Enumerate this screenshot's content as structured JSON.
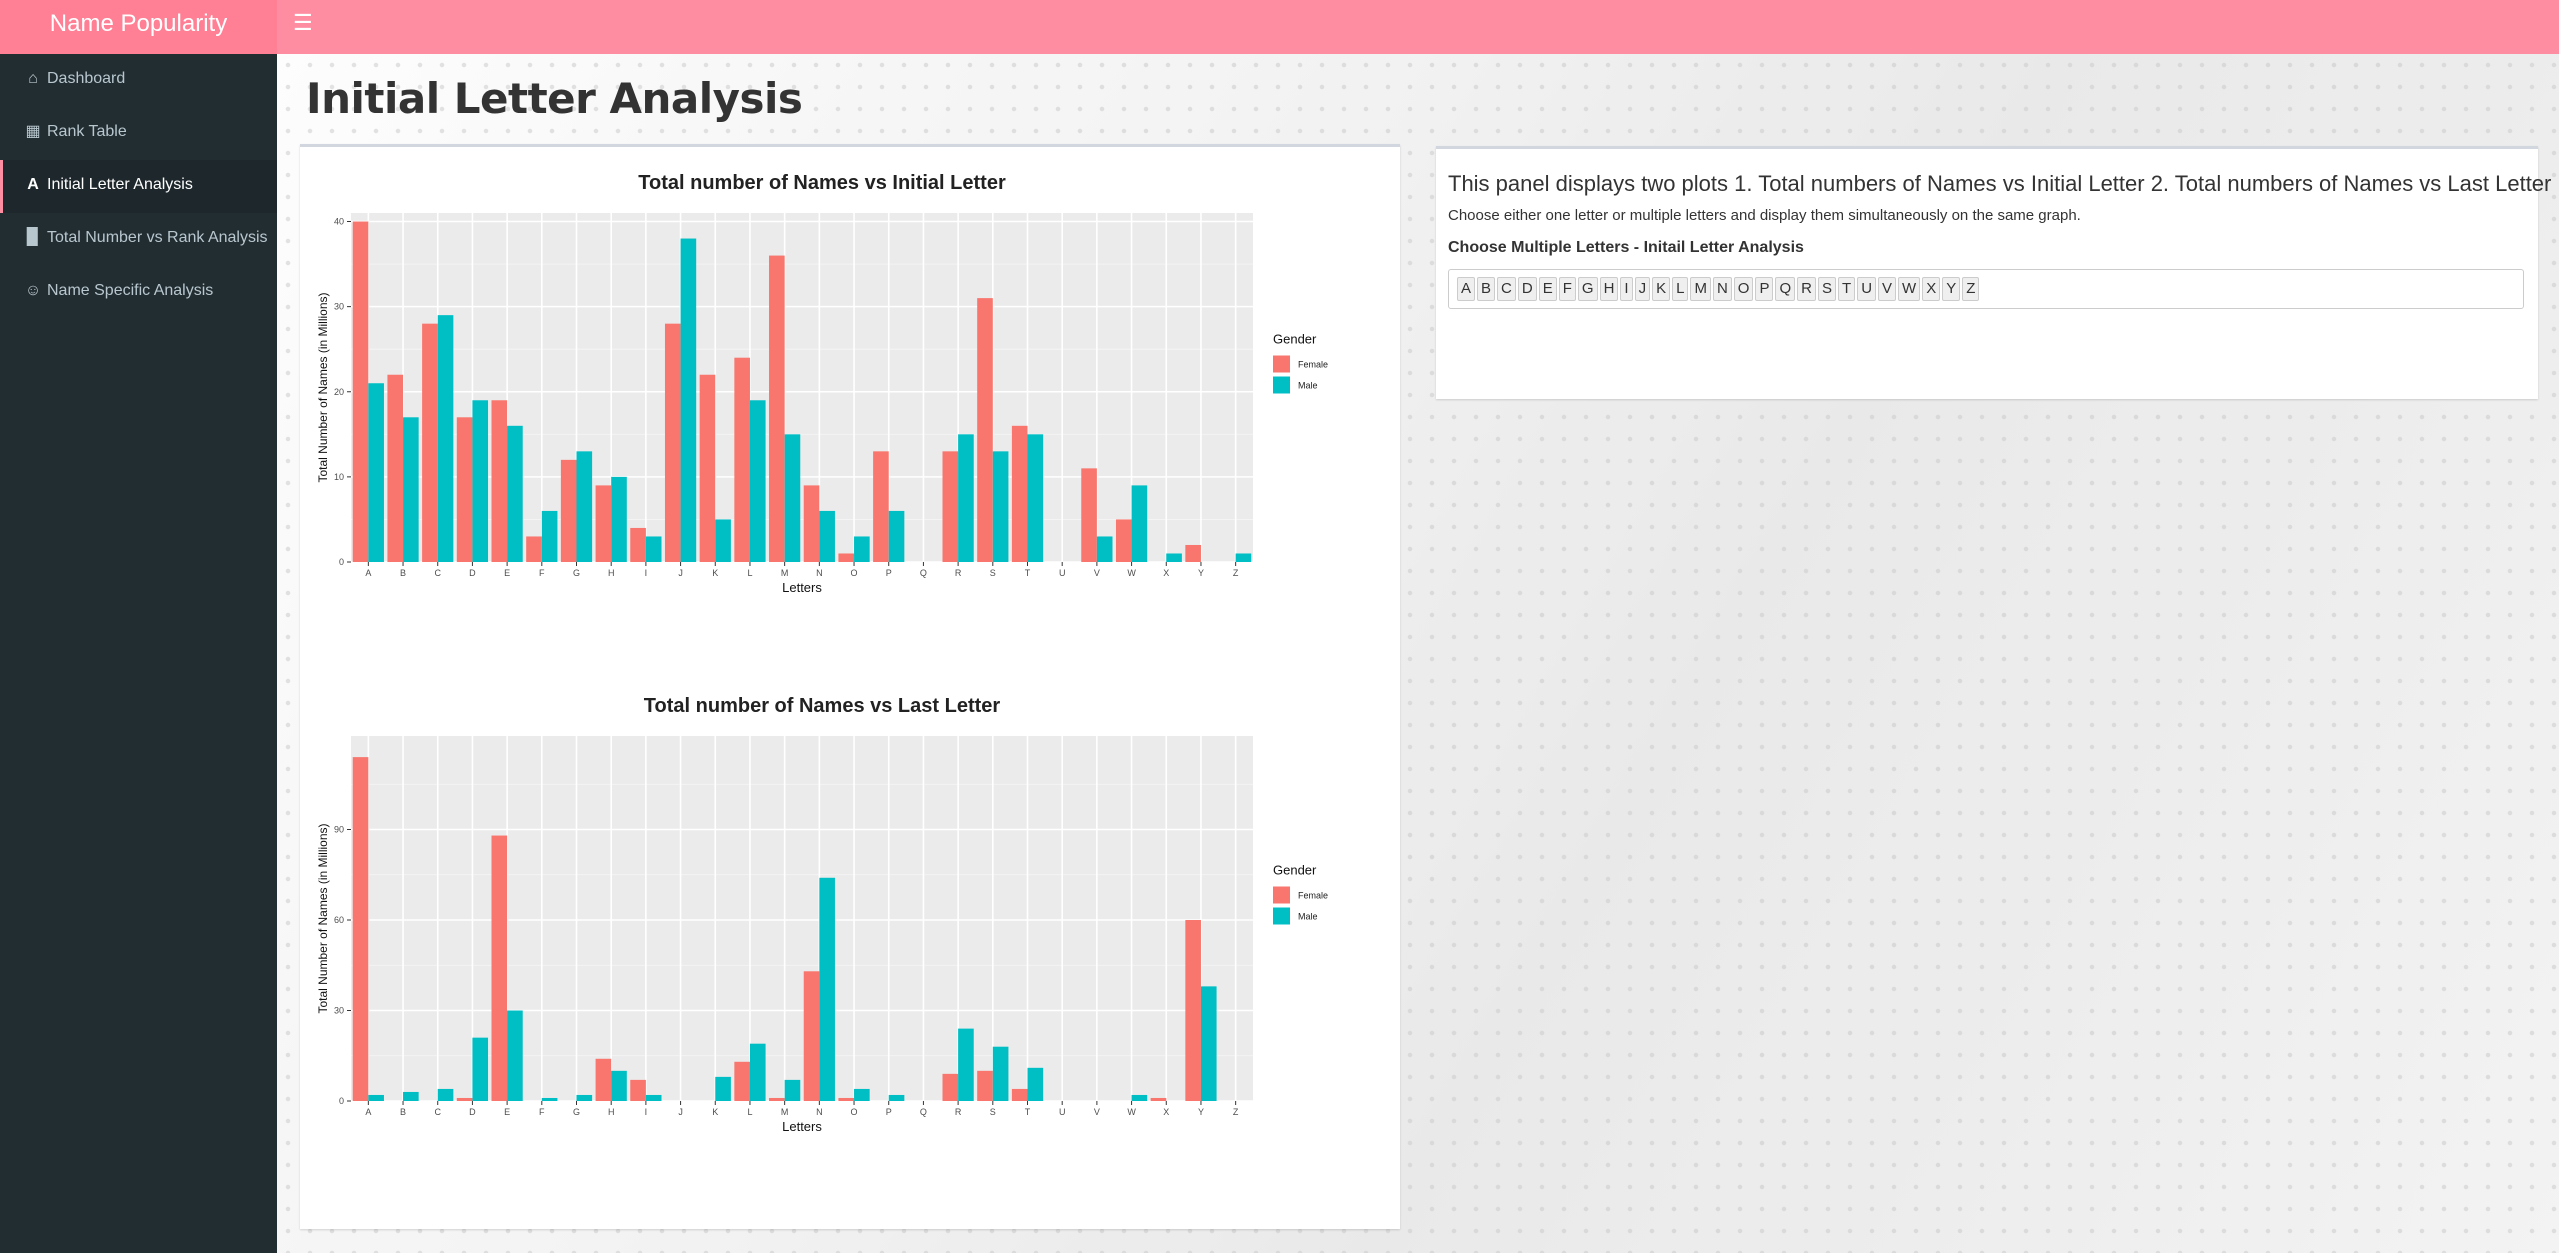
{
  "header": {
    "brand": "Name Popularity",
    "menu_icon": "hamburger-icon"
  },
  "sidebar": {
    "items": [
      {
        "label": "Dashboard",
        "icon": "home-icon",
        "active": false
      },
      {
        "label": "Rank Table",
        "icon": "table-icon",
        "active": false
      },
      {
        "label": "Initial Letter Analysis",
        "icon": "font-a-icon",
        "active": true
      },
      {
        "label": "Total Number vs Rank Analysis",
        "icon": "bar-chart-icon",
        "active": false
      },
      {
        "label": "Name Specific Analysis",
        "icon": "user-icon",
        "active": false
      }
    ]
  },
  "main": {
    "title": "Initial Letter Analysis",
    "panel": {
      "description": "This panel displays two plots 1. Total numbers of Names vs Initial Letter 2. Total numbers of Names vs Last Letter",
      "instruction": "Choose either one letter or multiple letters and display them simultaneously on the same graph.",
      "select_label": "Choose Multiple Letters - Initail Letter Analysis",
      "selected_letters": [
        "A",
        "B",
        "C",
        "D",
        "E",
        "F",
        "G",
        "H",
        "I",
        "J",
        "K",
        "L",
        "M",
        "N",
        "O",
        "P",
        "Q",
        "R",
        "S",
        "T",
        "U",
        "V",
        "W",
        "X",
        "Y",
        "Z"
      ]
    }
  },
  "colors": {
    "female": "#F8766D",
    "male": "#00BFC4",
    "panel_bg": "#EBEBEB",
    "accent": "#ff8da1",
    "sidebar": "#222d32"
  },
  "chart_data": [
    {
      "type": "bar",
      "title": "Total number of Names vs Initial Letter",
      "xlabel": "Letters",
      "ylabel": "Total Number of Names (in Millions)",
      "ylim": [
        0,
        41
      ],
      "yticks": [
        0,
        10,
        20,
        30,
        40
      ],
      "legend": {
        "title": "Gender",
        "position": "right"
      },
      "categories": [
        "A",
        "B",
        "C",
        "D",
        "E",
        "F",
        "G",
        "H",
        "I",
        "J",
        "K",
        "L",
        "M",
        "N",
        "O",
        "P",
        "Q",
        "R",
        "S",
        "T",
        "U",
        "V",
        "W",
        "X",
        "Y",
        "Z"
      ],
      "series": [
        {
          "name": "Female",
          "values": [
            40,
            22,
            28,
            17,
            19,
            3,
            12,
            9,
            4,
            28,
            22,
            24,
            36,
            9,
            1,
            13,
            0,
            13,
            31,
            16,
            0,
            11,
            5,
            0,
            2,
            0
          ]
        },
        {
          "name": "Male",
          "values": [
            21,
            17,
            29,
            19,
            16,
            6,
            13,
            10,
            3,
            38,
            5,
            19,
            15,
            6,
            3,
            6,
            0,
            15,
            13,
            15,
            0,
            3,
            9,
            1,
            0,
            1
          ]
        }
      ]
    },
    {
      "type": "bar",
      "title": "Total number of Names vs Last Letter",
      "xlabel": "Letters",
      "ylabel": "Total Number of Names (in Millions)",
      "ylim": [
        0,
        121
      ],
      "yticks": [
        0,
        30,
        60,
        90
      ],
      "legend": {
        "title": "Gender",
        "position": "right"
      },
      "categories": [
        "A",
        "B",
        "C",
        "D",
        "E",
        "F",
        "G",
        "H",
        "I",
        "J",
        "K",
        "L",
        "M",
        "N",
        "O",
        "P",
        "Q",
        "R",
        "S",
        "T",
        "U",
        "V",
        "W",
        "X",
        "Y",
        "Z"
      ],
      "series": [
        {
          "name": "Female",
          "values": [
            114,
            0,
            0,
            1,
            88,
            0,
            0,
            14,
            7,
            0,
            0,
            13,
            1,
            43,
            1,
            0,
            0,
            9,
            10,
            4,
            0,
            0,
            0,
            1,
            60,
            0
          ]
        },
        {
          "name": "Male",
          "values": [
            2,
            3,
            4,
            21,
            30,
            1,
            2,
            10,
            2,
            0,
            8,
            19,
            7,
            74,
            4,
            2,
            0,
            24,
            18,
            11,
            0,
            0,
            2,
            0,
            38,
            0
          ]
        }
      ]
    }
  ]
}
